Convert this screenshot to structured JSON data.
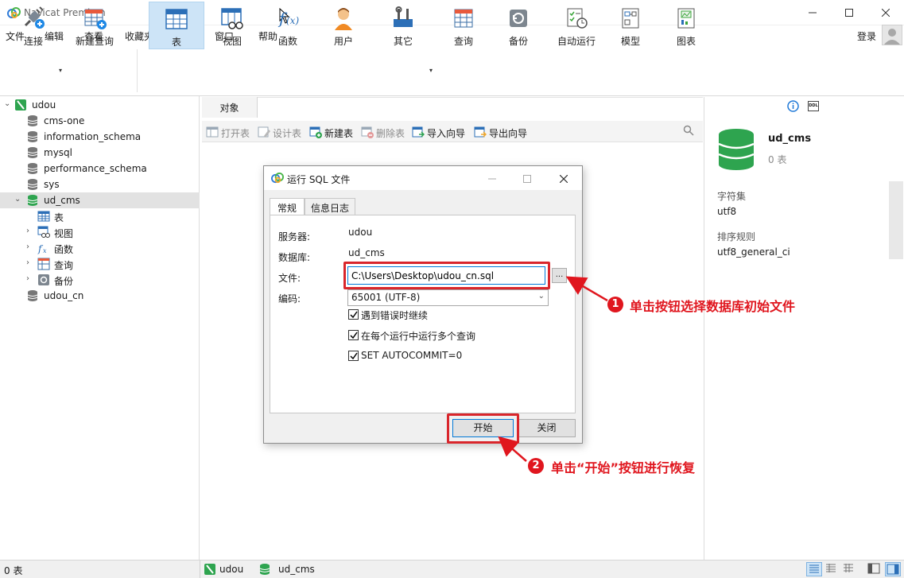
{
  "window": {
    "title": "Navicat Premium"
  },
  "menu": {
    "items": [
      "文件",
      "编辑",
      "查看",
      "收藏夹",
      "工具",
      "窗口",
      "帮助"
    ],
    "login": "登录"
  },
  "toolbar": {
    "buttons": [
      {
        "label": "连接",
        "icon": "plug-icon"
      },
      {
        "label": "新建查询",
        "icon": "new-query-icon"
      },
      {
        "label": "表",
        "icon": "table-icon",
        "active": true
      },
      {
        "label": "视图",
        "icon": "view-icon"
      },
      {
        "label": "函数",
        "icon": "function-icon"
      },
      {
        "label": "用户",
        "icon": "user-icon"
      },
      {
        "label": "其它",
        "icon": "tools-icon"
      },
      {
        "label": "查询",
        "icon": "query-icon"
      },
      {
        "label": "备份",
        "icon": "backup-icon"
      },
      {
        "label": "自动运行",
        "icon": "schedule-icon"
      },
      {
        "label": "模型",
        "icon": "model-icon"
      },
      {
        "label": "图表",
        "icon": "chart-icon"
      }
    ]
  },
  "tree": {
    "connection": "udou",
    "databases": [
      "cms-one",
      "information_schema",
      "mysql",
      "performance_schema",
      "sys"
    ],
    "open_db": "ud_cms",
    "open_db_children": [
      "表",
      "视图",
      "函数",
      "查询",
      "备份"
    ],
    "last_db": "udou_cn"
  },
  "objects": {
    "tab": "对象",
    "actions": [
      {
        "label": "打开表",
        "disabled": true
      },
      {
        "label": "设计表",
        "disabled": true
      },
      {
        "label": "新建表",
        "disabled": false
      },
      {
        "label": "删除表",
        "disabled": true
      },
      {
        "label": "导入向导",
        "disabled": false
      },
      {
        "label": "导出向导",
        "disabled": false
      }
    ]
  },
  "info": {
    "db_name": "ud_cms",
    "table_count": "0 表",
    "charset_label": "字符集",
    "charset_value": "utf8",
    "collation_label": "排序规则",
    "collation_value": "utf8_general_ci",
    "ddl_badge": "DDL"
  },
  "status": {
    "count": "0 表",
    "connection": "udou",
    "database": "ud_cms"
  },
  "dialog": {
    "title": "运行 SQL 文件",
    "tabs": [
      "常规",
      "信息日志"
    ],
    "server_label": "服务器:",
    "server_value": "udou",
    "database_label": "数据库:",
    "database_value": "ud_cms",
    "file_label": "文件:",
    "file_value": "C:\\Users\\Desktop\\udou_cn.sql",
    "browse_label": "...",
    "encoding_label": "编码:",
    "encoding_value": "65001 (UTF-8)",
    "options": [
      {
        "label": "遇到错误时继续",
        "checked": true
      },
      {
        "label": "在每个运行中运行多个查询",
        "checked": true
      },
      {
        "label": "SET AUTOCOMMIT=0",
        "checked": true
      }
    ],
    "start_label": "开始",
    "close_label": "关闭"
  },
  "annotations": {
    "step1_number": "1",
    "step1_text": "单击按钮选择数据库初始文件",
    "step2_number": "2",
    "step2_text": "单击“开始”按钮进行恢复",
    "color": "#e0161e"
  }
}
